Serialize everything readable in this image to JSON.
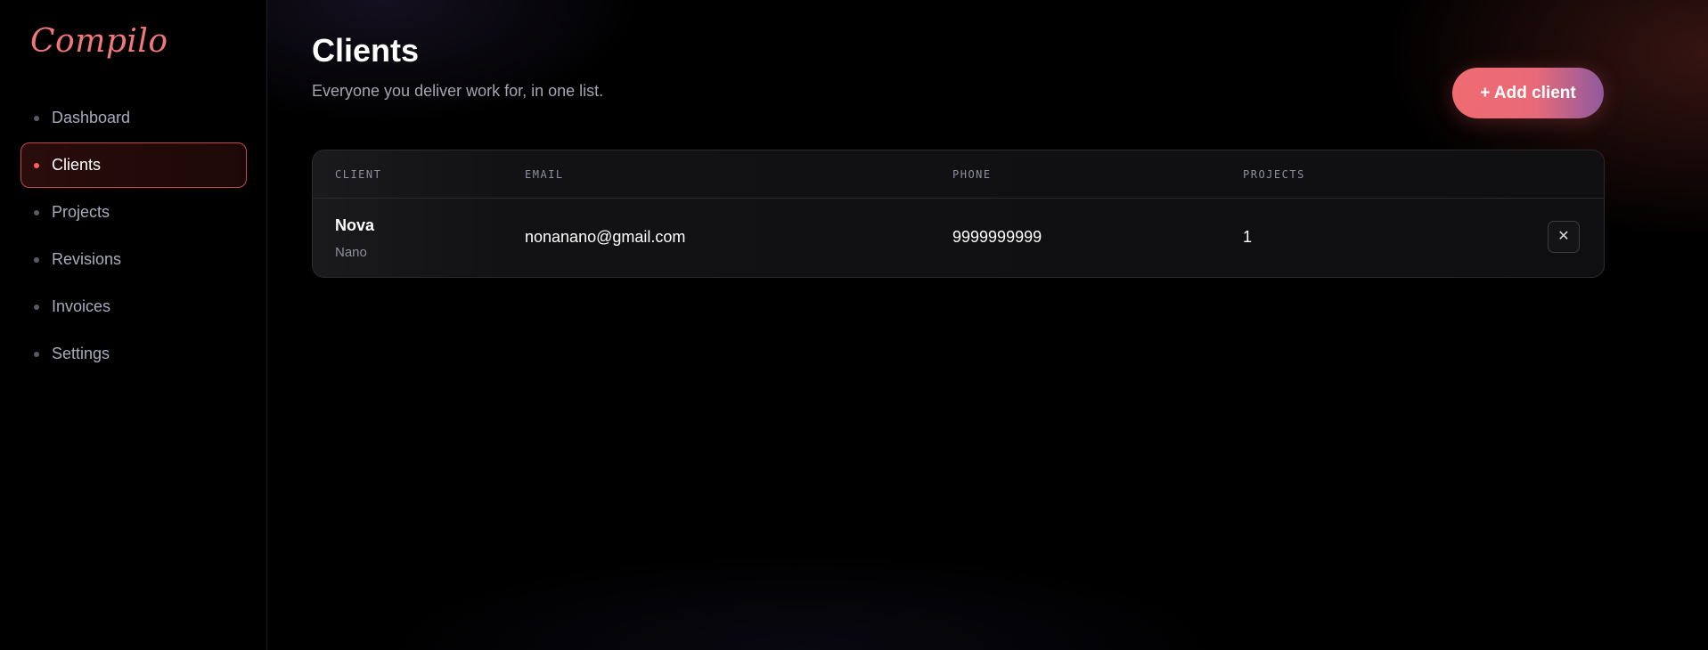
{
  "app": {
    "logo": "Compilo"
  },
  "sidebar": {
    "items": [
      {
        "label": "Dashboard",
        "active": false
      },
      {
        "label": "Clients",
        "active": true
      },
      {
        "label": "Projects",
        "active": false
      },
      {
        "label": "Revisions",
        "active": false
      },
      {
        "label": "Invoices",
        "active": false
      },
      {
        "label": "Settings",
        "active": false
      }
    ]
  },
  "header": {
    "title": "Clients",
    "subtitle": "Everyone you deliver work for, in one list.",
    "add_button": "+ Add client"
  },
  "table": {
    "columns": [
      "CLIENT",
      "EMAIL",
      "PHONE",
      "PROJECTS"
    ],
    "rows": [
      {
        "name": "Nova",
        "company": "Nano",
        "email": "nonanano@gmail.com",
        "phone": "9999999999",
        "projects": "1",
        "delete_icon": "close-icon"
      }
    ]
  },
  "colors": {
    "accent": "#f06b72",
    "active_border": "#c44a4a",
    "background": "#000000"
  }
}
